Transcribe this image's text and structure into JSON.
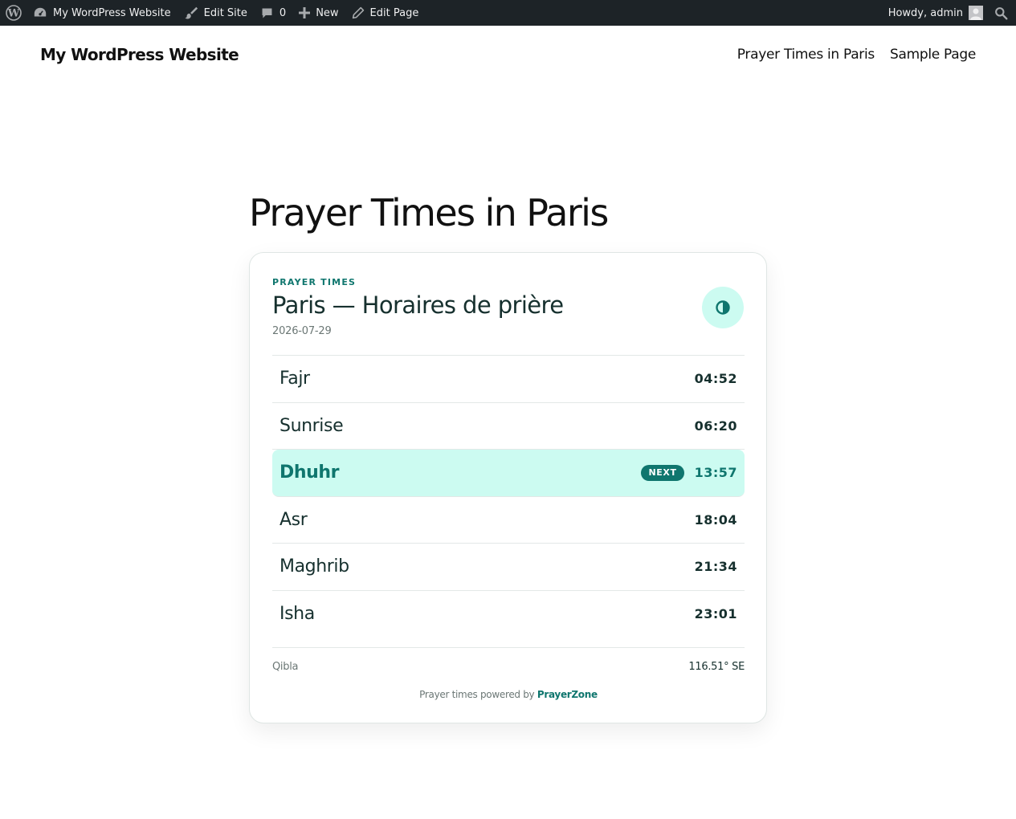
{
  "admin_bar": {
    "site_name": "My WordPress Website",
    "edit_site": "Edit Site",
    "comments_count": "0",
    "new": "New",
    "edit_page": "Edit Page",
    "greeting": "Howdy, admin"
  },
  "header": {
    "site_title": "My WordPress Website",
    "nav": [
      {
        "label": "Prayer Times in Paris"
      },
      {
        "label": "Sample Page"
      }
    ]
  },
  "page": {
    "title": "Prayer Times in Paris"
  },
  "widget": {
    "eyebrow": "PRAYER TIMES",
    "title": "Paris — Horaires de prière",
    "date": "2026-07-29",
    "prayers": [
      {
        "name": "Fajr",
        "time": "04:52"
      },
      {
        "name": "Sunrise",
        "time": "06:20"
      },
      {
        "name": "Dhuhr",
        "time": "13:57",
        "badge": "NEXT"
      },
      {
        "name": "Asr",
        "time": "18:04"
      },
      {
        "name": "Maghrib",
        "time": "21:34"
      },
      {
        "name": "Isha",
        "time": "23:01"
      }
    ],
    "qibla_label": "Qibla",
    "qibla_value": "116.51° SE",
    "powered_prefix": "Prayer times powered by",
    "powered_link": "PrayerZone"
  },
  "colors": {
    "admin_bar_bg": "#1d2327",
    "accent": "#0f766e",
    "highlight_bg": "#ccfbf1"
  }
}
